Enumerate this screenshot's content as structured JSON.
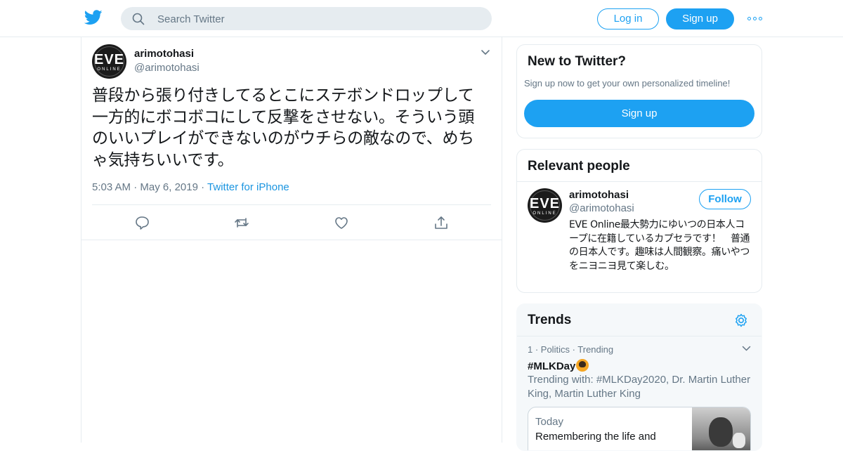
{
  "colors": {
    "accent": "#1da1f2",
    "secondary_text": "#657786",
    "divider": "#e6ecf0"
  },
  "header": {
    "logo_icon": "twitter-bird-icon",
    "search": {
      "placeholder": "Search Twitter",
      "icon": "search-icon"
    },
    "login_label": "Log in",
    "signup_label": "Sign up",
    "more_icon": "more-dots-icon"
  },
  "tweet": {
    "author_name": "arimotohasi",
    "author_handle": "@arimotohasi",
    "avatar_text": "EVE",
    "avatar_subtext": "ONLINE",
    "text": "普段から張り付きしてるとこにステボンドロップして一方的にボコボコにして反撃をさせない。そういう頭のいいプレイができないのがウチらの敵なので、めちゃ気持ちいいです。",
    "time": "5:03 AM",
    "sep1": "·",
    "date": "May 6, 2019",
    "sep2": "·",
    "source": "Twitter for iPhone",
    "action_icons": [
      "reply-icon",
      "retweet-icon",
      "like-icon",
      "share-icon"
    ]
  },
  "new_to_twitter": {
    "title": "New to Twitter?",
    "subtitle": "Sign up now to get your own personalized timeline!",
    "signup_label": "Sign up"
  },
  "relevant_people": {
    "title": "Relevant people",
    "person": {
      "name": "arimotohasi",
      "handle": "@arimotohasi",
      "follow_label": "Follow",
      "bio": "EVE Online最大勢力にゆいつの日本人コープに在籍しているカプセラです！　普通の日本人です。趣味は人間観察。痛いやつをニヨニヨ見て楽しむ。"
    }
  },
  "trends": {
    "title": "Trends",
    "settings_icon": "gear-icon",
    "items": [
      {
        "meta": "1 · Politics · Trending",
        "name": "#MLKDay",
        "trending_with": "Trending with: #MLKDay2020, Dr. Martin Luther King, Martin Luther King",
        "moment": {
          "label": "Today",
          "title": "Remembering the life and"
        }
      }
    ]
  }
}
